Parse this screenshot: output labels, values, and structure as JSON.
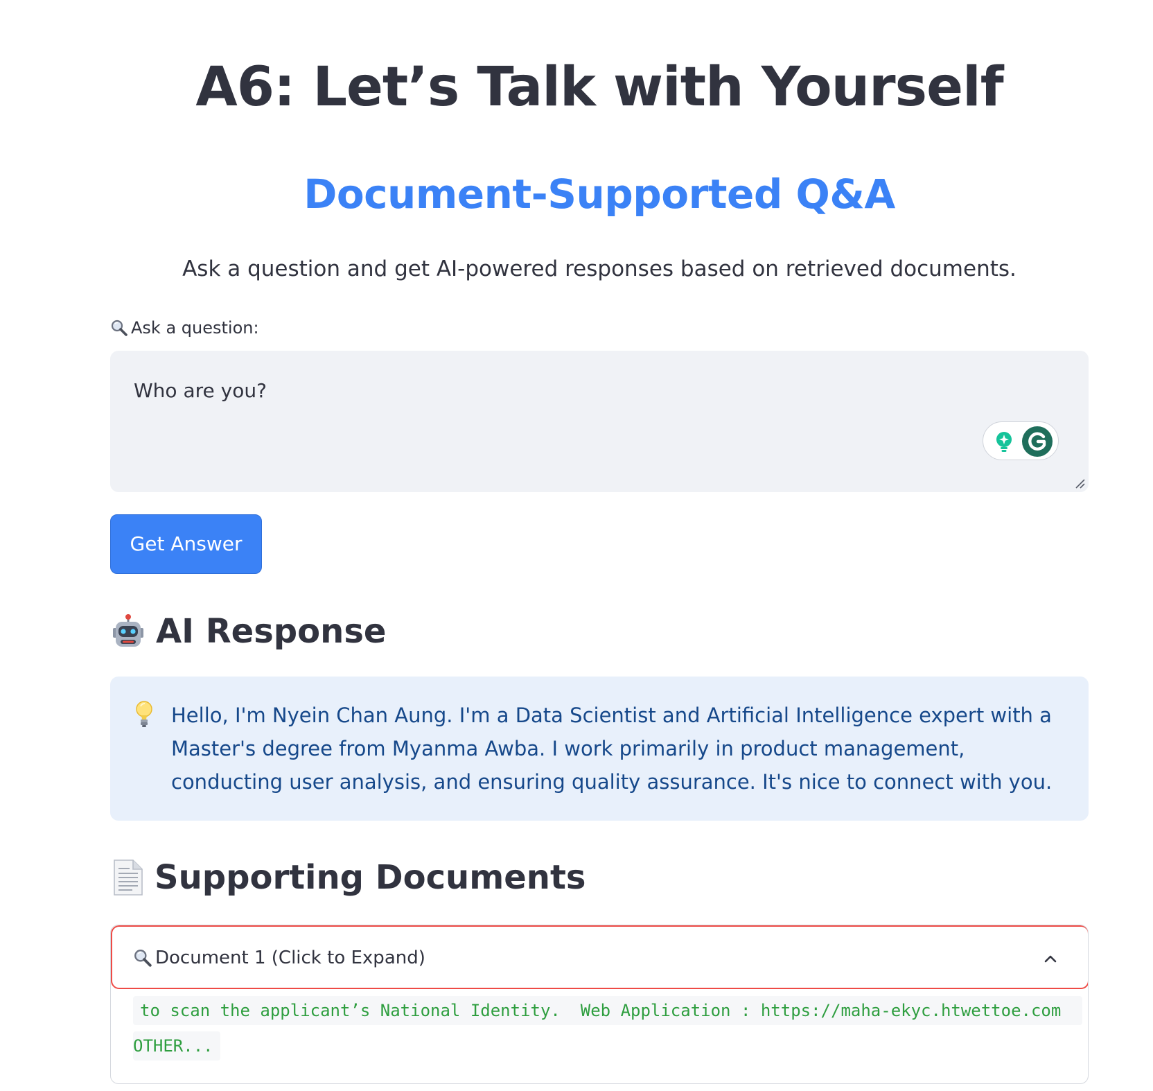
{
  "app": {
    "title": "A6: Let’s Talk with Yourself",
    "subtitle": "Document-Supported Q&A",
    "intro": "Ask a question and get AI-powered responses based on retrieved documents."
  },
  "question": {
    "label": "Ask a question:",
    "label_icon": "magnifying-glass-icon",
    "value": "Who are you?",
    "extension_icons": [
      "grammarly-suggestion-icon",
      "grammarly-icon"
    ]
  },
  "actions": {
    "get_answer_label": "Get Answer"
  },
  "response": {
    "heading": "AI Response",
    "heading_icon": "robot-icon",
    "box_icon": "lightbulb-icon",
    "text": "Hello, I'm Nyein Chan Aung. I'm a Data Scientist and Artificial Intelligence expert with a Master's degree from Myanma Awba. I work primarily in product management, conducting user analysis, and ensuring quality assurance. It's nice to connect with you."
  },
  "documents": {
    "heading": "Supporting Documents",
    "heading_icon": "page-icon",
    "items": [
      {
        "title": "Document 1 (Click to Expand)",
        "title_icon": "magnifying-glass-icon",
        "expanded": true,
        "content_lines": [
          "to scan the applicant’s National Identity.  Web Application : https://maha-ekyc.htwettoe.com",
          "OTHER..."
        ]
      }
    ]
  },
  "colors": {
    "accent": "#3b82f6",
    "heading_text": "#31333f",
    "input_background": "#f0f2f6",
    "info_background": "#e8f0fb",
    "info_text": "#16488a",
    "code_text": "#2e9e3f",
    "focus_border": "#ee4b46"
  }
}
